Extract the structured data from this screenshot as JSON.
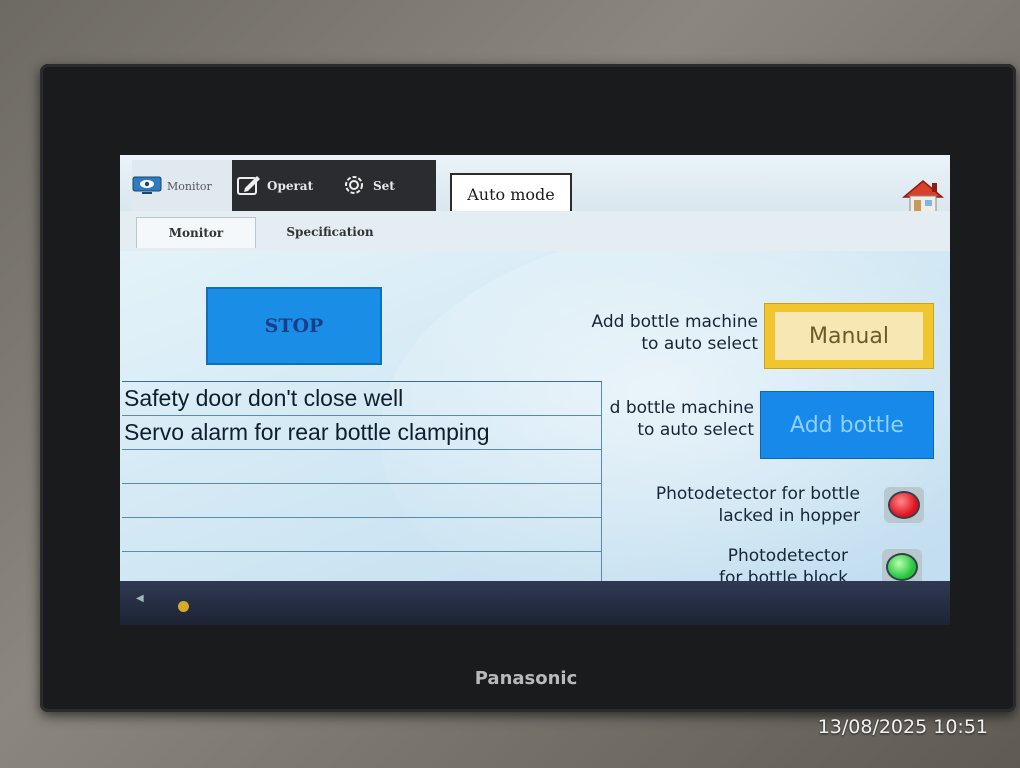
{
  "device": {
    "brand": "Panasonic"
  },
  "photo_timestamp": "13/08/2025 10:51",
  "nav": {
    "monitor_label": "Monitor",
    "operat_label": "Operat",
    "set_label": "Set"
  },
  "mode": {
    "label": "Auto mode"
  },
  "tabs": [
    {
      "label": "Monitor"
    },
    {
      "label": "Specification"
    }
  ],
  "stop_button": {
    "label": "STOP"
  },
  "alarms": [
    "Safety door don't close well",
    "Servo alarm for rear bottle clamping",
    "",
    "",
    "",
    ""
  ],
  "controls": {
    "manual_label_line1": "Add bottle machine",
    "manual_label_line2": "to auto select",
    "manual_button": "Manual",
    "add_label_line1": "d bottle machine",
    "add_label_line2": "to auto select",
    "add_button": "Add bottle",
    "photo1_line1": "Photodetector for bottle",
    "photo1_line2": "lacked in hopper",
    "photo2_line1": "Photodetector",
    "photo2_line2": "for bottle block"
  },
  "indicators": {
    "hopper_lamp_color": "#e10f1f",
    "block_lamp_color": "#22c43a"
  },
  "icons": {
    "monitor": "monitor-icon",
    "operat": "pen-icon",
    "set": "gear-icon",
    "home": "home-icon"
  }
}
